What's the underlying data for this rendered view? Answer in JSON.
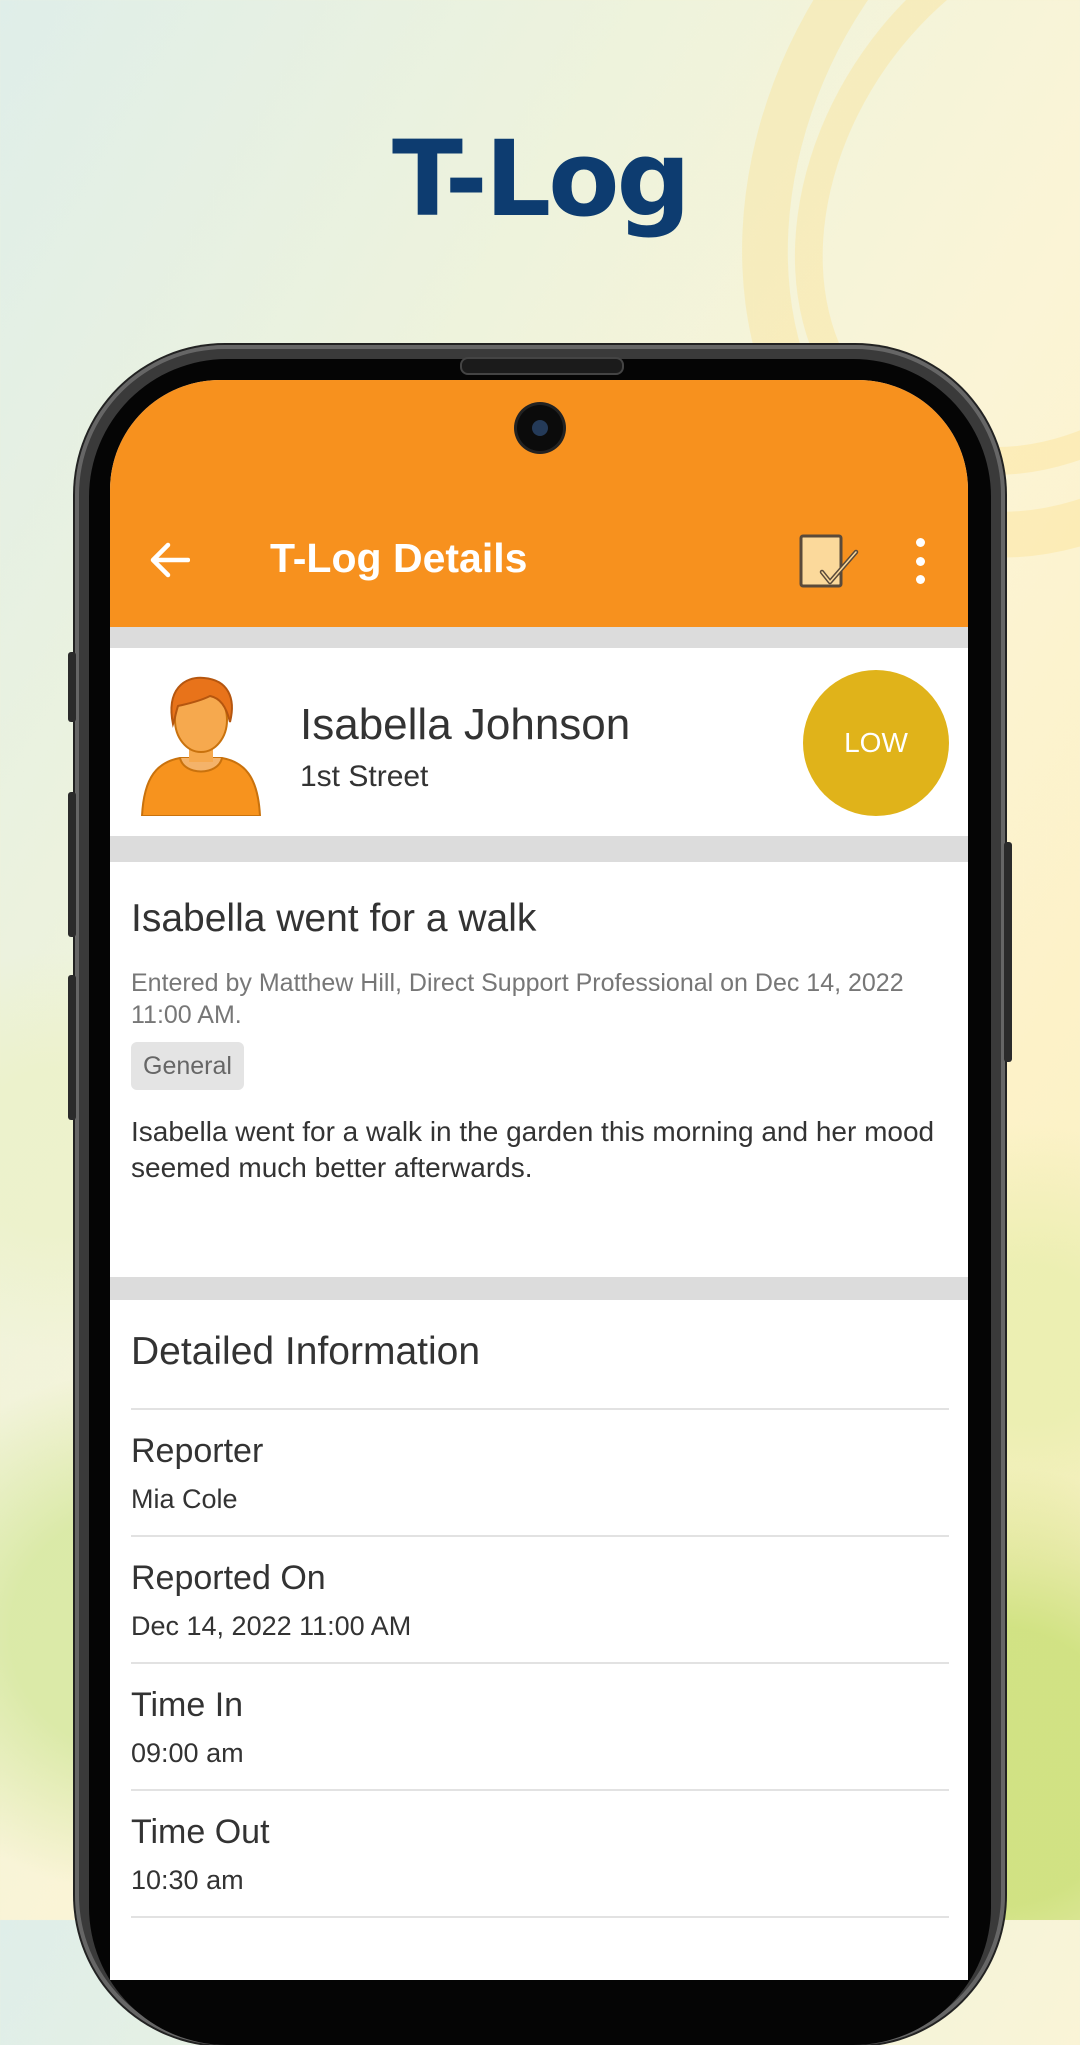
{
  "hero": {
    "title": "T-Log"
  },
  "appbar": {
    "title": "T-Log Details",
    "color": "#f7911e",
    "back_icon": "arrow-left-icon",
    "sign_icon": "signature-check-icon",
    "more_icon": "more-vertical-icon"
  },
  "person": {
    "name": "Isabella Johnson",
    "address": "1st Street",
    "risk": "LOW",
    "risk_color": "#e0b31a",
    "avatar_icon": "female-avatar-icon"
  },
  "log": {
    "title": "Isabella went for a walk",
    "meta": "Entered by Matthew Hill, Direct Support Professional on Dec 14, 2022 11:00 AM.",
    "tag": "General",
    "body": "Isabella went for a walk in the garden this morning and her mood seemed much better afterwards."
  },
  "details": {
    "heading": "Detailed Information",
    "rows": [
      {
        "label": "Reporter",
        "value": "Mia Cole"
      },
      {
        "label": "Reported On",
        "value": "Dec 14, 2022 11:00 AM"
      },
      {
        "label": "Time In",
        "value": "09:00 am"
      },
      {
        "label": "Time Out",
        "value": "10:30 am"
      }
    ]
  }
}
